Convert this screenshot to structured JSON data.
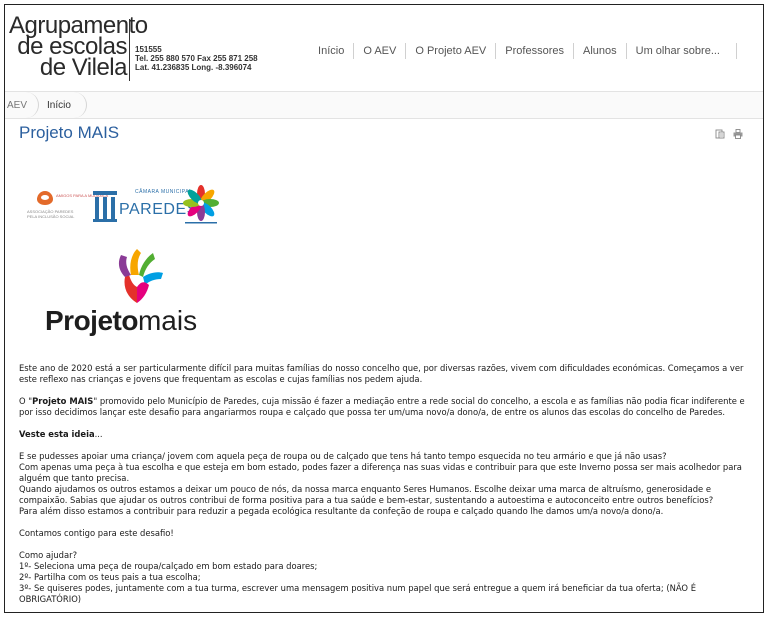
{
  "header": {
    "logo": {
      "line1": "Agrupamento",
      "line2": "de escolas",
      "line3": "de Vilela"
    },
    "contact": {
      "code": "151555",
      "phone": "Tel. 255 880 570 Fax 255 871 258",
      "coords": "Lat. 41.236835 Long. -8.396074"
    },
    "nav": [
      "Início",
      "O AEV",
      "O Projeto AEV",
      "Professores",
      "Alunos",
      "Um olhar sobre..."
    ]
  },
  "breadcrumb": {
    "home": "AEV",
    "current": "Início"
  },
  "page": {
    "title": "Projeto MAIS",
    "tools": [
      "pdf-icon",
      "print-icon"
    ]
  },
  "partner_logos": {
    "assoc_small": "AMIGOS PARA A MUDANÇA",
    "assoc_name1": "ASSOCIAÇÃO PAREDES",
    "assoc_name2": "PELA INCLUSÃO SOCIAL",
    "camara_small": "CÂMARA MUNICIPAL",
    "camara_big": "PAREDES"
  },
  "mais_logo": {
    "bold": "Projeto",
    "light": "mais",
    "colors": [
      "#e4312b",
      "#f7a600",
      "#52ae32",
      "#009fe3",
      "#8a3b96"
    ]
  },
  "content": {
    "p1": "Este ano de 2020 está a ser particularmente difícil para muitas famílias do nosso concelho que, por diversas razões, vivem com dificuldades económicas. Começamos a ver este reflexo nas crianças e jovens que frequentam as escolas e cujas famílias nos pedem ajuda.",
    "p2_pre": "O \"",
    "p2_bold": "Projeto MAIS",
    "p2_post": "\" promovido pelo Município de Paredes, cuja missão é fazer a mediação entre a rede social do concelho, a escola e as famílias não podia ficar indiferente e por isso decidimos lançar este desafio para angariarmos roupa e calçado que possa ter um/uma novo/a dono/a, de entre os alunos das escolas do concelho de Paredes.",
    "p3_bold": "Veste esta ideia",
    "p3_post": "...",
    "p4_l1": "E se pudesses apoiar uma criança/ jovem com aquela peça de roupa ou de calçado que tens há tanto tempo esquecida no teu armário e que já não usas?",
    "p4_l2": "Com apenas uma peça à tua escolha e que esteja em bom estado, podes fazer a diferença nas suas vidas e contribuir para que este Inverno possa ser mais acolhedor para alguém que tanto precisa.",
    "p4_l3": "Quando ajudamos os outros estamos a deixar um pouco de nós, da nossa marca enquanto Seres Humanos. Escolhe deixar uma marca de altruísmo, generosidade e compaixão. Sabias que ajudar os outros contribui de forma positiva para a tua saúde e bem-estar, sustentando a autoestima e autoconceito entre outros benefícios?",
    "p4_l4": "Para além disso estamos a contribuir para reduzir a pegada ecológica resultante da confeção de roupa e calçado quando lhe damos um/a novo/a dono/a.",
    "p5": "Contamos contigo para este desafio!",
    "p6_l1": "Como ajudar?",
    "p6_l2": "1º- Seleciona uma peça de roupa/calçado em bom estado para doares;",
    "p6_l3": "2º- Partilha com os teus pais a tua escolha;",
    "p6_l4": "3º- Se quiseres podes, juntamente com a tua turma, escrever uma mensagem positiva num papel que será entregue a quem irá beneficiar da tua oferta; (NÃO É OBRIGATÓRIO)"
  }
}
